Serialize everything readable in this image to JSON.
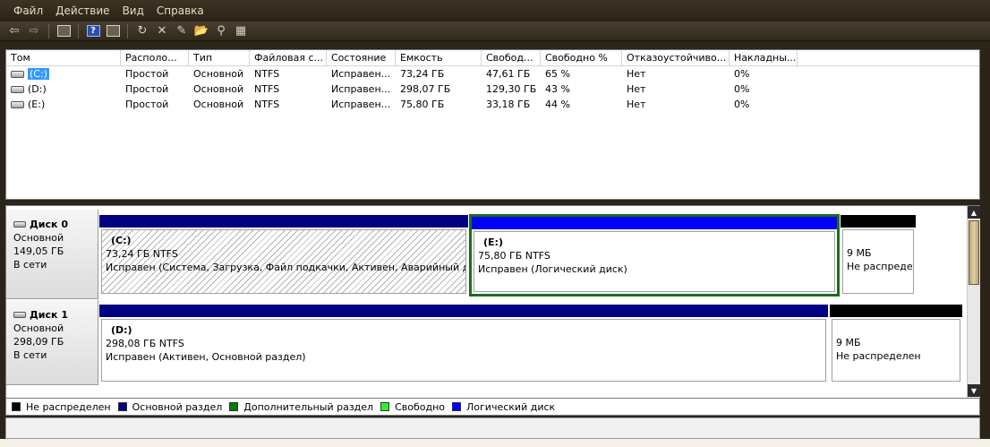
{
  "menu": [
    "Файл",
    "Действие",
    "Вид",
    "Справка"
  ],
  "toolbar": {
    "icons": [
      "back-icon",
      "forward-icon",
      "console-tree-icon",
      "help-icon",
      "properties-icon",
      "refresh-icon",
      "delete-icon",
      "open-icon",
      "explore-icon",
      "search-icon",
      "settings-icon"
    ]
  },
  "list": {
    "columns": [
      "Том",
      "Располо...",
      "Тип",
      "Файловая с...",
      "Состояние",
      "Емкость",
      "Свобод...",
      "Свободно %",
      "Отказоустойчиво...",
      "Накладны..."
    ],
    "rows": [
      {
        "volume": "(C:)",
        "layout": "Простой",
        "type": "Основной",
        "fs": "NTFS",
        "status": "Исправен...",
        "capacity": "73,24 ГБ",
        "free": "47,61 ГБ",
        "free_pct": "65 %",
        "fault": "Нет",
        "overhead": "0%"
      },
      {
        "volume": "(D:)",
        "layout": "Простой",
        "type": "Основной",
        "fs": "NTFS",
        "status": "Исправен...",
        "capacity": "298,07 ГБ",
        "free": "129,30 ГБ",
        "free_pct": "43 %",
        "fault": "Нет",
        "overhead": "0%"
      },
      {
        "volume": "(E:)",
        "layout": "Простой",
        "type": "Основной",
        "fs": "NTFS",
        "status": "Исправен...",
        "capacity": "75,80 ГБ",
        "free": "33,18 ГБ",
        "free_pct": "44 %",
        "fault": "Нет",
        "overhead": "0%"
      }
    ]
  },
  "disks": [
    {
      "name": "Диск 0",
      "kind": "Основной",
      "size": "149,05 ГБ",
      "state": "В сети",
      "partitions": [
        {
          "name": "(C:)",
          "size": "73,24 ГБ NTFS",
          "status": "Исправен (Система, Загрузка, Файл подкачки, Активен, Аварийный дамп"
        },
        {
          "name": "(E:)",
          "size": "75,80 ГБ NTFS",
          "status": "Исправен (Логический диск)"
        },
        {
          "size": "9 МБ",
          "status": "Не распреде"
        }
      ]
    },
    {
      "name": "Диск 1",
      "kind": "Основной",
      "size": "298,09 ГБ",
      "state": "В сети",
      "partitions": [
        {
          "name": "(D:)",
          "size": "298,08 ГБ NTFS",
          "status": "Исправен (Активен, Основной раздел)"
        },
        {
          "size": "9 МБ",
          "status": "Не распределен"
        }
      ]
    }
  ],
  "legend": [
    {
      "label": "Не распределен",
      "color": "#000000"
    },
    {
      "label": "Основной раздел",
      "color": "#000080"
    },
    {
      "label": "Дополнительный раздел",
      "color": "#008000"
    },
    {
      "label": "Свободно",
      "color": "#33ee33"
    },
    {
      "label": "Логический диск",
      "color": "#0000ff"
    }
  ],
  "colors": {
    "primary_bar": "#000080",
    "logical_bar": "#0000ff",
    "unallocated_bar": "#000000",
    "extended_border": "#1e6b1e",
    "selection": "#3399ff"
  }
}
